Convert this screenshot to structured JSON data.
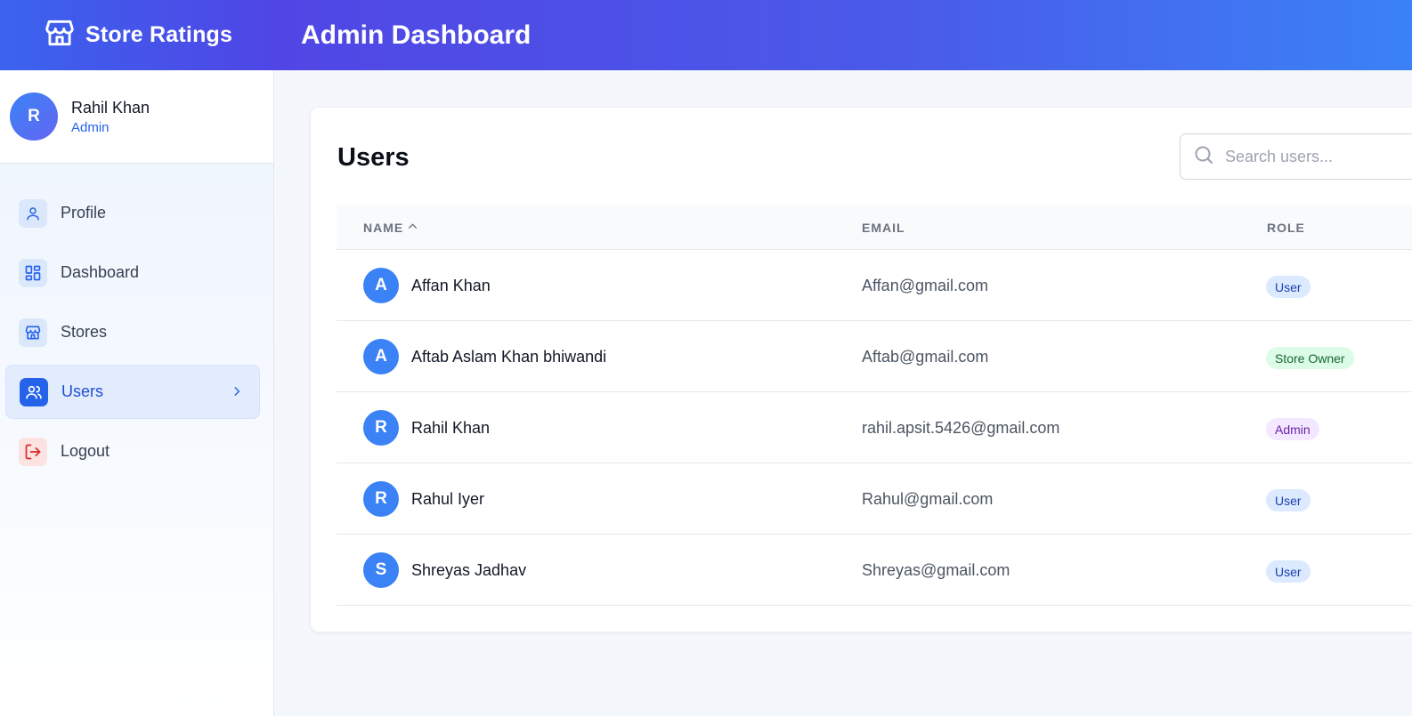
{
  "brand": {
    "title": "Store Ratings",
    "icon": "store-icon"
  },
  "header": {
    "title": "Admin Dashboard"
  },
  "current_user": {
    "initial": "R",
    "name": "Rahil Khan",
    "role": "Admin"
  },
  "nav": [
    {
      "label": "Profile",
      "icon": "user-icon"
    },
    {
      "label": "Dashboard",
      "icon": "grid-icon"
    },
    {
      "label": "Stores",
      "icon": "store-icon"
    },
    {
      "label": "Users",
      "icon": "users-icon",
      "active": true
    },
    {
      "label": "Logout",
      "icon": "logout-icon"
    }
  ],
  "users_panel": {
    "title": "Users",
    "search_placeholder": "Search users...",
    "columns": {
      "name": "NAME",
      "email": "EMAIL",
      "role": "ROLE"
    },
    "rows": [
      {
        "initial": "A",
        "name": "Affan Khan",
        "email": "Affan@gmail.com",
        "role": "User"
      },
      {
        "initial": "A",
        "name": "Aftab Aslam Khan bhiwandi",
        "email": "Aftab@gmail.com",
        "role": "Store Owner"
      },
      {
        "initial": "R",
        "name": "Rahil Khan",
        "email": "rahil.apsit.5426@gmail.com",
        "role": "Admin"
      },
      {
        "initial": "R",
        "name": "Rahul Iyer",
        "email": "Rahul@gmail.com",
        "role": "User"
      },
      {
        "initial": "S",
        "name": "Shreyas Jadhav",
        "email": "Shreyas@gmail.com",
        "role": "User"
      }
    ]
  },
  "colors": {
    "accent": "#2563eb",
    "header_start": "#3b63ee",
    "header_end": "#3b82f6",
    "avatar": "#3b82f6"
  }
}
